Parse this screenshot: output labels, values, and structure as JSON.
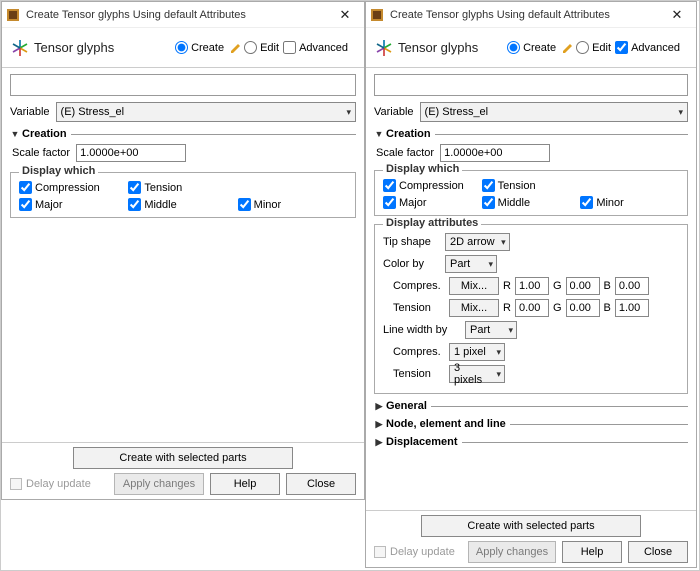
{
  "windowTitle": "Create Tensor glyphs Using default Attributes",
  "toolbar": {
    "title": "Tensor glyphs",
    "create": "Create",
    "edit": "Edit",
    "advanced": "Advanced"
  },
  "variable": {
    "label": "Variable",
    "value": "(E) Stress_el"
  },
  "creation": {
    "title": "Creation",
    "scaleFactorLabel": "Scale factor",
    "scaleFactorValue": "1.0000e+00"
  },
  "displayWhich": {
    "title": "Display which",
    "compression": "Compression",
    "tension": "Tension",
    "major": "Major",
    "middle": "Middle",
    "minor": "Minor"
  },
  "displayAttrs": {
    "title": "Display attributes",
    "tipShapeLabel": "Tip shape",
    "tipShapeValue": "2D arrow",
    "colorByLabel": "Color by",
    "colorByValue": "Part",
    "compresLabel": "Compres.",
    "tensionLabel": "Tension",
    "mix": "Mix...",
    "r": "R",
    "g": "G",
    "b": "B",
    "compR": "1.00",
    "compG": "0.00",
    "compB": "0.00",
    "tensR": "0.00",
    "tensG": "0.00",
    "tensB": "1.00",
    "lineWidthByLabel": "Line width by",
    "lineWidthByValue": "Part",
    "lwCompValue": "1 pixel",
    "lwTensValue": "3 pixels"
  },
  "sections": {
    "general": "General",
    "nodeElemLine": "Node, element and line",
    "displacement": "Displacement"
  },
  "footer": {
    "createWithSelected": "Create with selected parts",
    "delayUpdate": "Delay update",
    "applyChanges": "Apply changes",
    "help": "Help",
    "close": "Close"
  }
}
